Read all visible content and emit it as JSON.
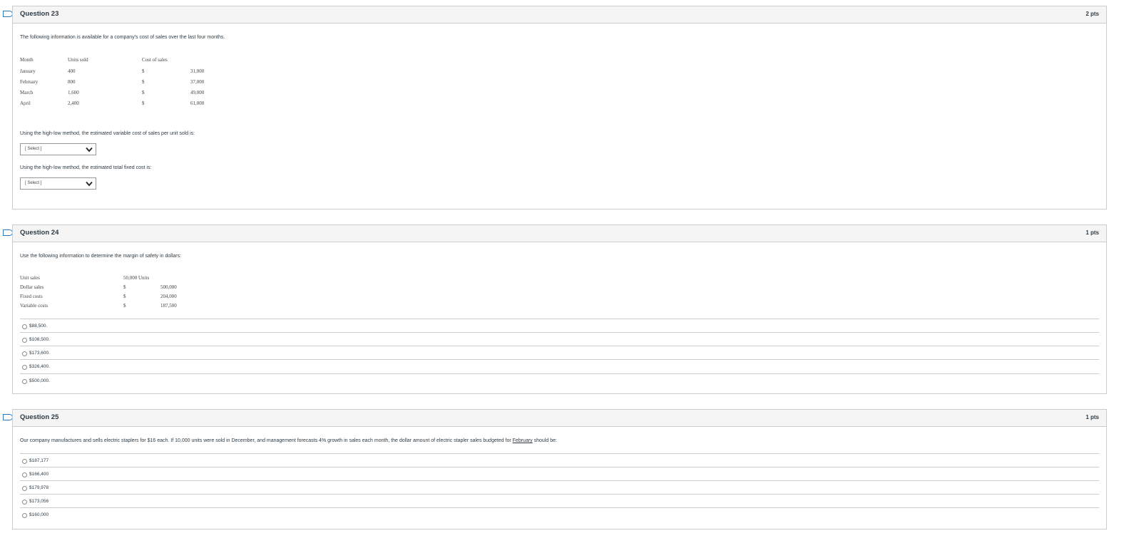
{
  "q23": {
    "title": "Question 23",
    "points": "2 pts",
    "intro": "The following information is available for a company's cost of sales over the last four months.",
    "table": {
      "headers": [
        "Month",
        "Units sold",
        "Cost of sales"
      ],
      "rows": [
        {
          "month": "January",
          "units": "400",
          "cur": "$",
          "cost": "31,000"
        },
        {
          "month": "February",
          "units": "800",
          "cur": "$",
          "cost": "37,000"
        },
        {
          "month": "March",
          "units": "1,600",
          "cur": "$",
          "cost": "49,000"
        },
        {
          "month": "April",
          "units": "2,400",
          "cur": "$",
          "cost": "61,000"
        }
      ]
    },
    "prompt1": "Using the high-low method, the estimated variable cost of sales per unit sold is:",
    "select1": "[ Select ]",
    "prompt2": "Using the high-low method, the estimated total fixed cost is:",
    "select2": "[ Select ]"
  },
  "q24": {
    "title": "Question 24",
    "points": "1 pts",
    "intro": "Use the following information to determine the margin of safety in dollars:",
    "table": {
      "rows": [
        {
          "label": "Unit sales",
          "cur": "50,000 Units",
          "value": ""
        },
        {
          "label": "Dollar sales",
          "cur": "$",
          "value": "500,000"
        },
        {
          "label": "Fixed costs",
          "cur": "$",
          "value": "204,000"
        },
        {
          "label": "Variable costs",
          "cur": "$",
          "value": "187,500"
        }
      ]
    },
    "answers": [
      "$88,500.",
      "$108,500.",
      "$173,600.",
      "$326,400.",
      "$500,000."
    ]
  },
  "q25": {
    "title": "Question 25",
    "points": "1 pts",
    "intro_a": "Our company manufactures and sells electric staplers for $16 each. If 10,000 units were sold in December, and management forecasts 4% growth in sales each month, the dollar amount of electric stapler sales budgeted for ",
    "intro_b": "February",
    "intro_c": " should be:",
    "answers": [
      "$187,177",
      "$166,400",
      "$179,978",
      "$173,056",
      "$160,000"
    ]
  }
}
